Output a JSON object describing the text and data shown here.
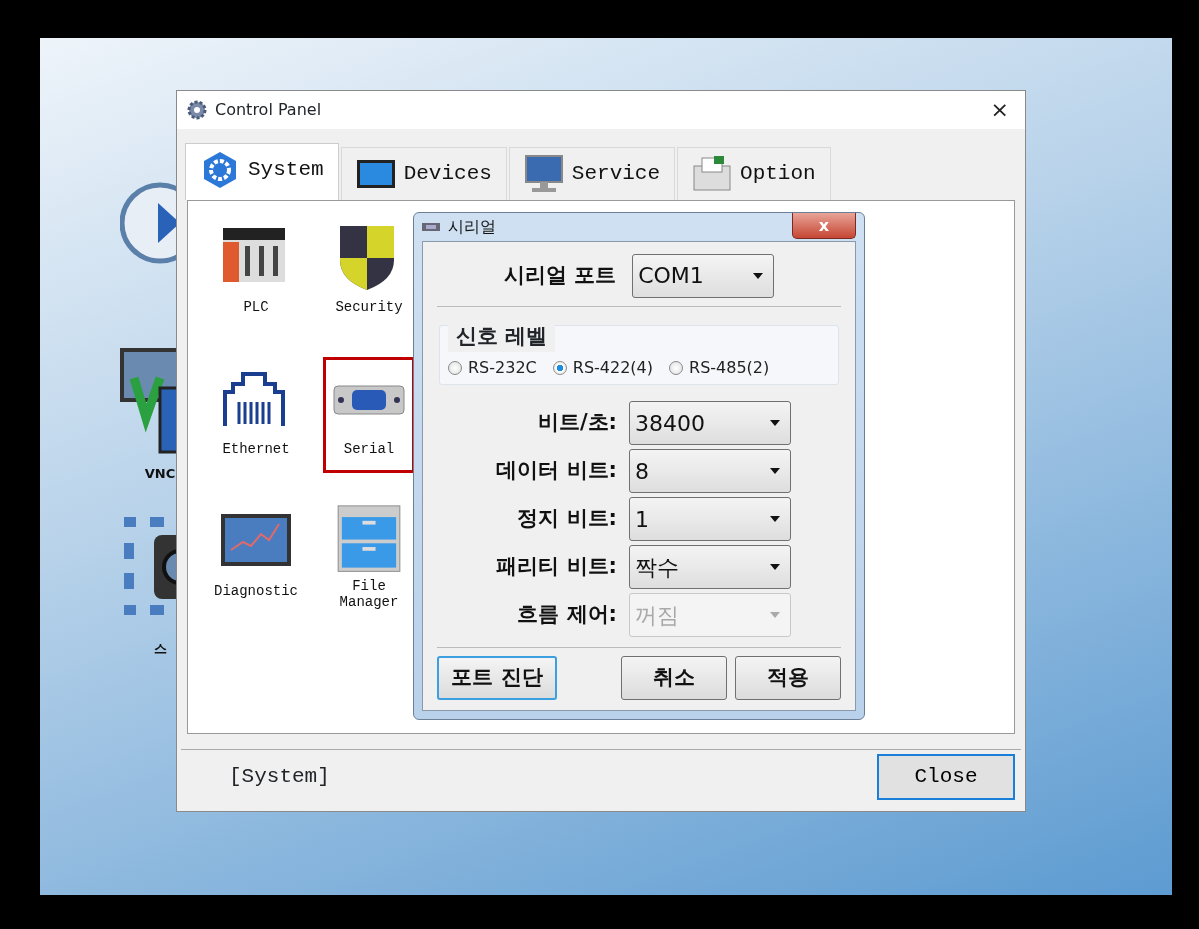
{
  "desktop_icons": [
    {
      "kind": "play"
    },
    {
      "kind": "vnc",
      "label": "VNC"
    },
    {
      "kind": "camera",
      "label": "스"
    }
  ],
  "control_panel": {
    "title": "Control Panel",
    "close_glyph": "×",
    "tabs": [
      {
        "kind": "system",
        "label": "System",
        "selected": true
      },
      {
        "kind": "devices",
        "label": "Devices",
        "selected": false
      },
      {
        "kind": "service",
        "label": "Service",
        "selected": false
      },
      {
        "kind": "option",
        "label": "Option",
        "selected": false
      }
    ],
    "items": [
      {
        "kind": "plc",
        "label": "PLC",
        "selected": false
      },
      {
        "kind": "security",
        "label": "Security",
        "selected": false
      },
      {
        "kind": "ethernet",
        "label": "Ethernet",
        "selected": false
      },
      {
        "kind": "serial",
        "label": "Serial",
        "selected": true
      },
      {
        "kind": "diagnostic",
        "label": "Diagnostic",
        "selected": false
      },
      {
        "kind": "file-manager",
        "label": "File\nManager",
        "selected": false
      }
    ],
    "status": "[System]",
    "close_button": "Close"
  },
  "serial_dialog": {
    "title": "시리얼",
    "close_glyph": "x",
    "port_label": "시리얼 포트",
    "port_value": "COM1",
    "signal_level": {
      "legend": "신호 레벨",
      "options": [
        {
          "label": "RS-232C",
          "selected": false
        },
        {
          "label": "RS-422(4)",
          "selected": true
        },
        {
          "label": "RS-485(2)",
          "selected": false
        }
      ]
    },
    "fields": [
      {
        "label": "비트/초:",
        "value": "38400",
        "disabled": false
      },
      {
        "label": "데이터 비트:",
        "value": "8",
        "disabled": false
      },
      {
        "label": "정지 비트:",
        "value": "1",
        "disabled": false
      },
      {
        "label": "패리티 비트:",
        "value": "짝수",
        "disabled": false
      },
      {
        "label": "흐름 제어:",
        "value": "꺼짐",
        "disabled": true
      }
    ],
    "buttons": [
      {
        "label": "포트 진단",
        "focused": true
      },
      {
        "label": "취소",
        "focused": false
      },
      {
        "label": "적용",
        "focused": false
      }
    ]
  }
}
